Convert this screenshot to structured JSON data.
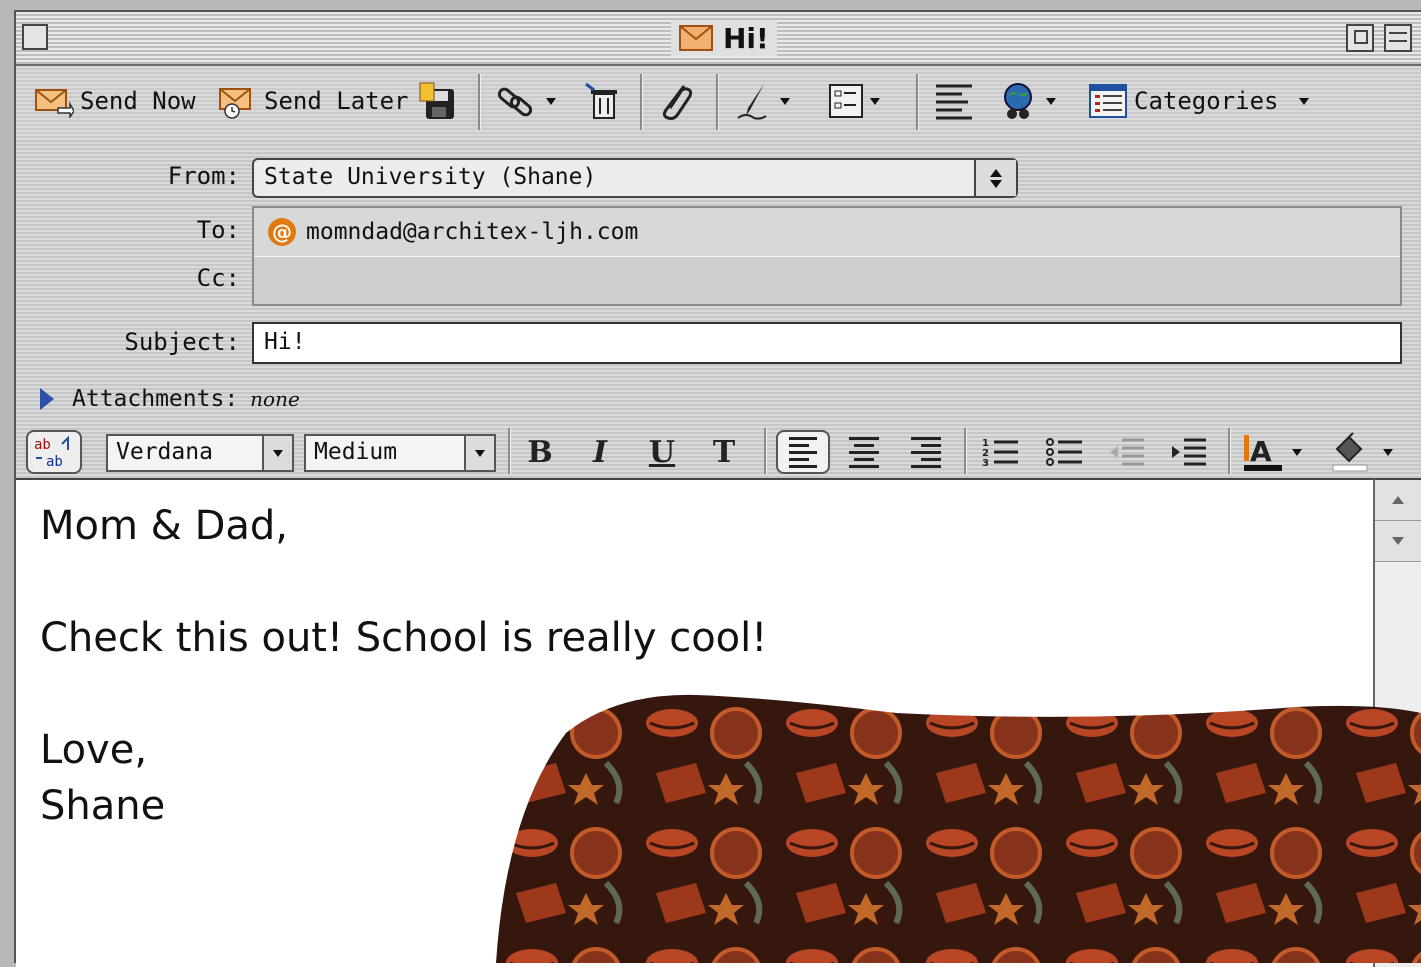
{
  "window": {
    "title": "Hi!"
  },
  "toolbar": {
    "send_now": "Send Now",
    "send_later": "Send Later",
    "categories": "Categories"
  },
  "header": {
    "from_label": "From:",
    "from_value": "State University (Shane)",
    "to_label": "To:",
    "to_value": "momndad@architex-ljh.com",
    "cc_label": "Cc:",
    "cc_value": "",
    "subject_label": "Subject:",
    "subject_value": "Hi!",
    "attachments_label": "Attachments:",
    "attachments_value": "none"
  },
  "format": {
    "font": "Verdana",
    "size": "Medium",
    "bold": "B",
    "italic": "I",
    "underline": "U",
    "teletype": "T"
  },
  "message": {
    "lines": [
      "Mom & Dad,",
      "",
      "Check this out! School is really cool!",
      "",
      "Love,",
      "Shane"
    ]
  },
  "colors": {
    "accent": "#e07a10",
    "disclosure": "#2a50a8"
  }
}
